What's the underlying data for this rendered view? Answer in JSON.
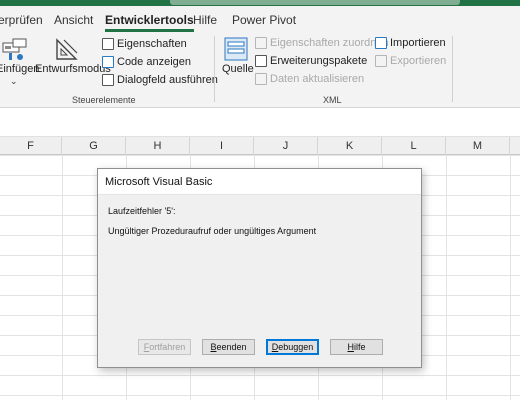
{
  "tabs": [
    {
      "label": "erprüfen"
    },
    {
      "label": "Ansicht"
    },
    {
      "label": "Entwicklertools",
      "active": true
    },
    {
      "label": "Hilfe"
    },
    {
      "label": "Power Pivot"
    }
  ],
  "ribbon": {
    "controls": {
      "insert_label": "Einfügen",
      "design_mode_label": "Entwurfsmodus",
      "properties_label": "Eigenschaften",
      "view_code_label": "Code anzeigen",
      "run_dialog_label": "Dialogfeld ausführen",
      "group_label": "Steuerelemente"
    },
    "xml": {
      "source_label": "Quelle",
      "map_properties_label": "Eigenschaften zuordnen",
      "expansion_packs_label": "Erweiterungspakete",
      "refresh_data_label": "Daten aktualisieren",
      "import_label": "Importieren",
      "export_label": "Exportieren",
      "group_label": "XML"
    }
  },
  "columns": [
    "F",
    "G",
    "H",
    "I",
    "J",
    "K",
    "L",
    "M"
  ],
  "dialog": {
    "title": "Microsoft Visual Basic",
    "error_line": "Laufzeitfehler '5':",
    "message": "Ungültiger Prozeduraufruf oder ungültiges Argument",
    "buttons": {
      "continue": {
        "first": "F",
        "rest": "ortfahren"
      },
      "end": {
        "first": "B",
        "rest": "eenden"
      },
      "debug": {
        "first": "D",
        "rest": "ebuggen"
      },
      "help": {
        "first": "H",
        "rest": "ilfe"
      }
    }
  },
  "colors": {
    "accent": "#217346",
    "focus": "#0078d7"
  }
}
